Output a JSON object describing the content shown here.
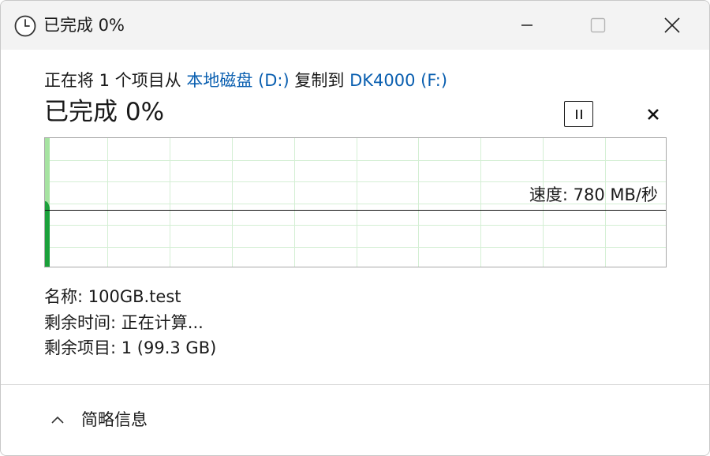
{
  "window": {
    "title": "已完成 0%"
  },
  "header": {
    "copy_prefix": "正在将 1 个项目从 ",
    "source": "本地磁盘 (D:)",
    "copy_middle": " 复制到 ",
    "destination": "DK4000 (F:)",
    "status": "已完成 0%"
  },
  "graph": {
    "speed_label": "速度: 780 MB/秒",
    "progress_fraction": 0.0
  },
  "details": {
    "name_label": "名称:",
    "name_value": "100GB.test",
    "time_label": "剩余时间:",
    "time_value": "正在计算...",
    "items_label": "剩余项目:",
    "items_value": "1 (99.3 GB)"
  },
  "footer": {
    "toggle_label": "简略信息"
  },
  "icons": {
    "title": "clock-icon",
    "minimize": "minimize-icon",
    "maximize": "maximize-icon",
    "close": "close-icon",
    "pause": "pause-icon",
    "cancel": "cancel-icon",
    "collapse": "chevron-up-icon"
  },
  "colors": {
    "link": "#0a5fb0",
    "graph_fill": "#1aa03a",
    "graph_fill_light": "#a6e3a1",
    "grid": "#d4efd4"
  }
}
